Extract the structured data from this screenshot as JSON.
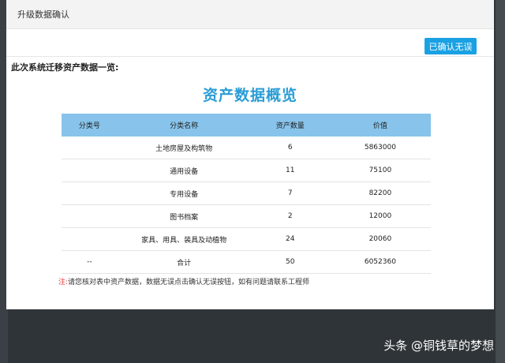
{
  "dialog": {
    "title": "升级数据确认",
    "confirm_button": "已确认无误",
    "section_heading": "此次系统迁移资产数据一览:",
    "report_title": "资产数据概览"
  },
  "table": {
    "headers": [
      "分类号",
      "分类名称",
      "资产数量",
      "价值"
    ],
    "rows": [
      {
        "code": "",
        "name": "土地房屋及构筑物",
        "count": "6",
        "value": "5863000"
      },
      {
        "code": "",
        "name": "通用设备",
        "count": "11",
        "value": "75100"
      },
      {
        "code": "",
        "name": "专用设备",
        "count": "7",
        "value": "82200"
      },
      {
        "code": "",
        "name": "图书档案",
        "count": "2",
        "value": "12000"
      },
      {
        "code": "",
        "name": "家具、用具、装具及动植物",
        "count": "24",
        "value": "20060"
      },
      {
        "code": "--",
        "name": "合计",
        "count": "50",
        "value": "6052360"
      }
    ]
  },
  "note": {
    "mark": "注:",
    "text": "请您核对表中资产数据，数据无误点击确认无误按钮，如有问题请联系工程师"
  },
  "watermark": "头条 @铜钱草的梦想",
  "colors": {
    "accent": "#1aa1e3",
    "header_bg": "#87c3ea",
    "title": "#2a9dd6",
    "note_mark": "#e63b3b"
  }
}
